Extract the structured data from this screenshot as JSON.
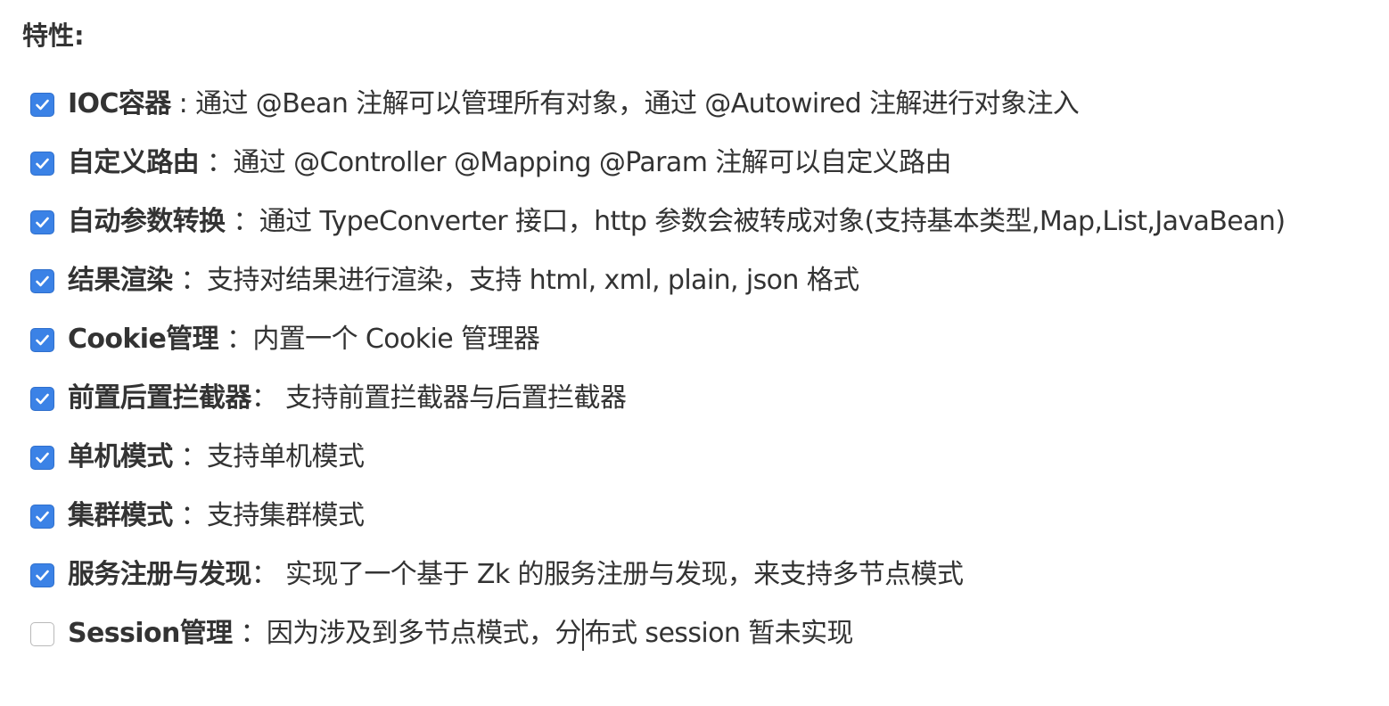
{
  "heading": "特性:",
  "items": [
    {
      "title": "IOC容器",
      "desc": " : 通过 @Bean 注解可以管理所有对象，通过 @Autowired 注解进行对象注入",
      "checked": true
    },
    {
      "title": "自定义路由",
      "desc": " ：通过 @Controller @Mapping @Param 注解可以自定义路由",
      "checked": true
    },
    {
      "title": "自动参数转换",
      "desc": " ：通过 TypeConverter 接口，http 参数会被转成对象(支持基本类型,Map,List,JavaBean)",
      "checked": true
    },
    {
      "title": "结果渲染",
      "desc": " ：支持对结果进行渲染，支持 html, xml, plain, json 格式",
      "checked": true
    },
    {
      "title": "Cookie管理",
      "desc": " ：内置一个 Cookie 管理器",
      "checked": true
    },
    {
      "title": "前置后置拦截器",
      "desc": "：  支持前置拦截器与后置拦截器",
      "checked": true
    },
    {
      "title": "单机模式",
      "desc": " ：支持单机模式",
      "checked": true
    },
    {
      "title": "集群模式",
      "desc": " ：支持集群模式",
      "checked": true
    },
    {
      "title": "服务注册与发现",
      "desc": "：  实现了一个基于 Zk 的服务注册与发现，来支持多节点模式",
      "checked": true
    },
    {
      "title": "Session管理",
      "desc_before_caret": " ：因为涉及到多节点模式，分",
      "desc_after_caret": "布式 session 暂未实现",
      "checked": false
    }
  ],
  "colors": {
    "checkbox_checked": "#3b82e6",
    "checkbox_unchecked_border": "#b9b9b9",
    "text": "#333333"
  }
}
